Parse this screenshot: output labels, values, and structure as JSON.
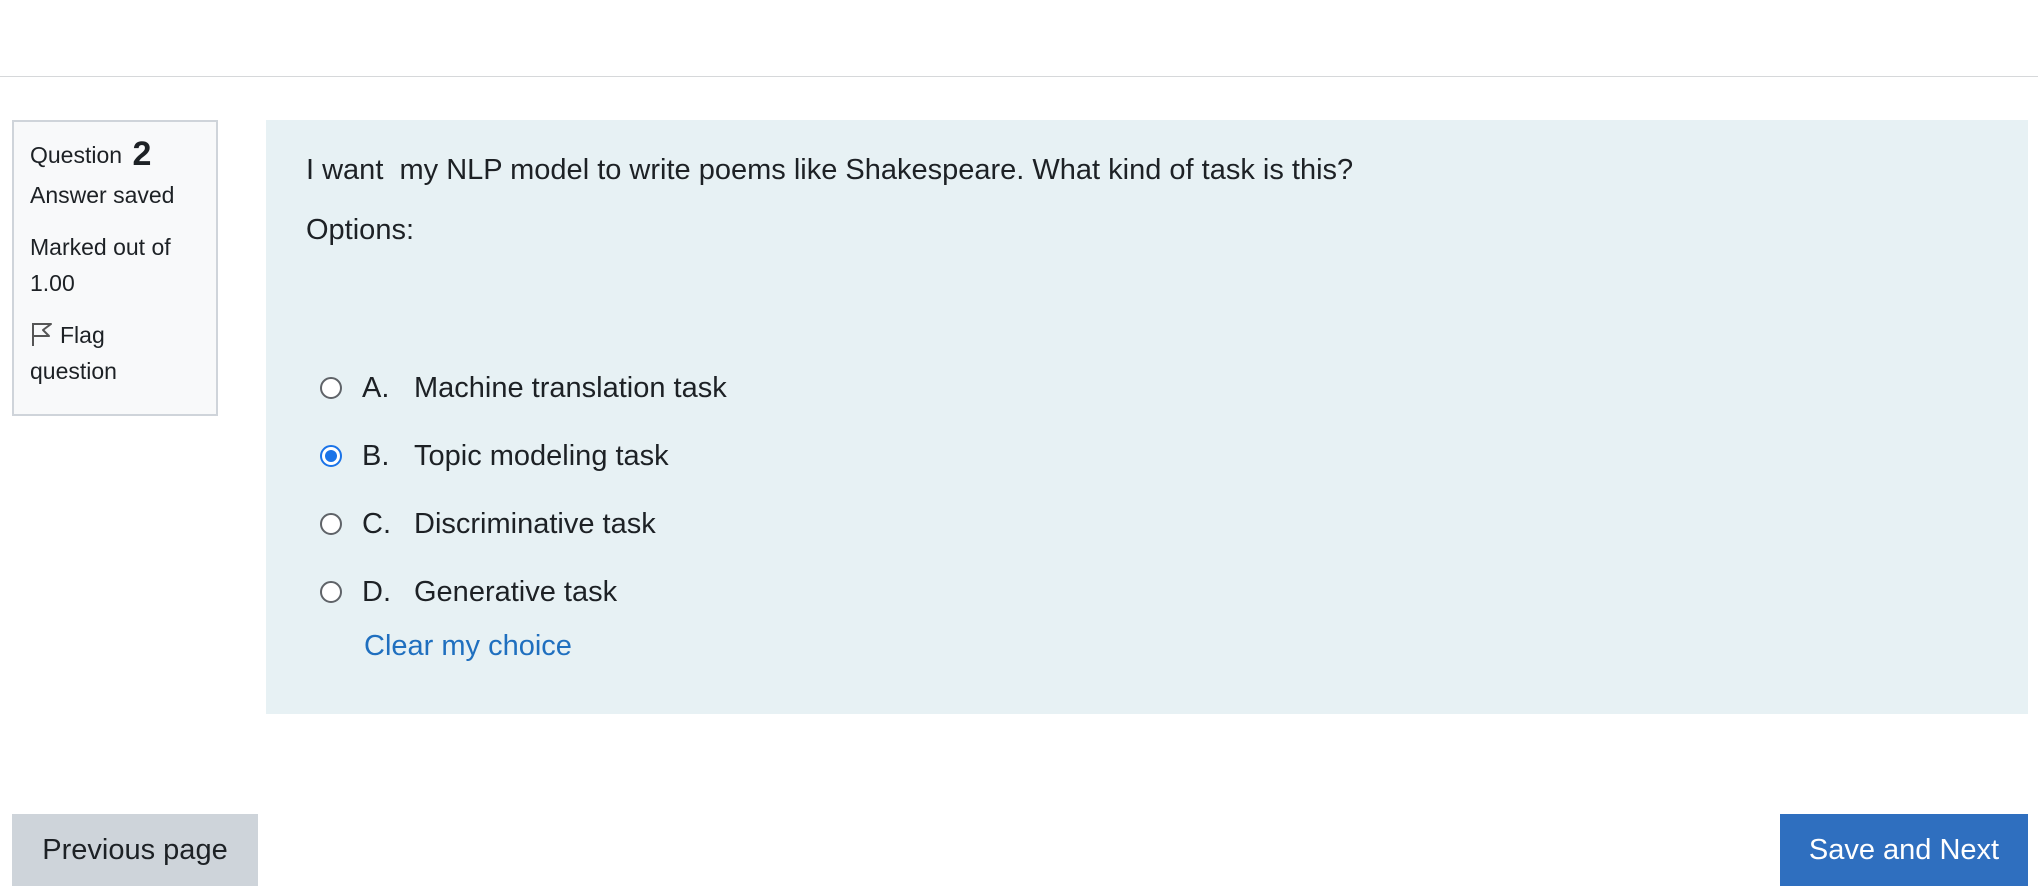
{
  "info": {
    "question_word": "Question",
    "question_number": "2",
    "state": "Answer saved",
    "grade_line1": "Marked out of",
    "grade_line2": "1.00",
    "flag_line1": "Flag",
    "flag_line2": "question",
    "flag_icon": "flag-outline-icon"
  },
  "question": {
    "text": "I want  my NLP model to write poems like Shakespeare. What kind of task is this?",
    "options_label": "Options:",
    "answers": [
      {
        "letter": "A.",
        "label": "Machine translation task",
        "selected": false
      },
      {
        "letter": "B.",
        "label": "Topic modeling task",
        "selected": true
      },
      {
        "letter": "C.",
        "label": "Discriminative task",
        "selected": false
      },
      {
        "letter": "D.",
        "label": "Generative task",
        "selected": false
      }
    ],
    "clear_label": "Clear my choice"
  },
  "navigation": {
    "previous_label": "Previous page",
    "next_label": "Save and Next"
  },
  "colors": {
    "content_bg": "#e7f1f4",
    "accent": "#2f6fbf",
    "link": "#1f6fbf",
    "radio_selected": "#1a73e8"
  }
}
